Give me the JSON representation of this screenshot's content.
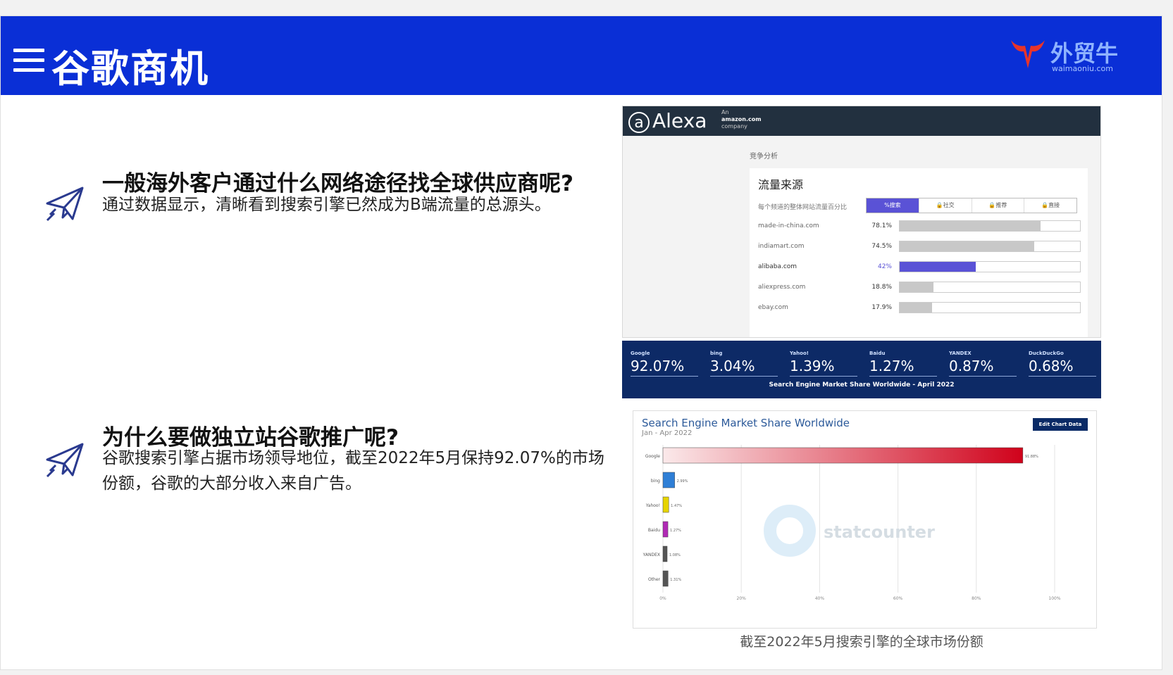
{
  "header": {
    "title": "谷歌商机",
    "brand_name": "外贸牛",
    "brand_url": "waimaoniu.com"
  },
  "section1": {
    "title": "一般海外客户通过什么网络途径找全球供应商呢?",
    "body": "通过数据显示，清晰看到搜索引擎已然成为B端流量的总源头。"
  },
  "section2": {
    "title": "为什么要做独立站谷歌推广呢?",
    "body": "谷歌搜索引擎占据市场领导地位，截至2022年5月保持92.07%的市场份额，谷歌的大部分收入来自广告。"
  },
  "alexa": {
    "logo": "Alexa",
    "tagline_an": "An",
    "tagline_company": "amazon.com",
    "tagline_suffix": "company",
    "breadcrumb": "竞争分析",
    "card_title": "流量来源",
    "card_label": "每个频道的整体网站流量百分比",
    "tabs": [
      "%搜索",
      "🔒社交",
      "🔒推荐",
      "🔒直接"
    ],
    "rows": [
      {
        "site": "made-in-china.com",
        "pct": "78.1%",
        "value": 78.1
      },
      {
        "site": "indiamart.com",
        "pct": "74.5%",
        "value": 74.5
      },
      {
        "site": "alibaba.com",
        "pct": "42%",
        "value": 42
      },
      {
        "site": "aliexpress.com",
        "pct": "18.8%",
        "value": 18.8
      },
      {
        "site": "ebay.com",
        "pct": "17.9%",
        "value": 17.9
      }
    ],
    "highlight_color": "#5a52d6"
  },
  "banner": {
    "items": [
      {
        "name": "Google",
        "value": "92.07%"
      },
      {
        "name": "bing",
        "value": "3.04%"
      },
      {
        "name": "Yahoo!",
        "value": "1.39%"
      },
      {
        "name": "Baidu",
        "value": "1.27%"
      },
      {
        "name": "YANDEX",
        "value": "0.87%"
      },
      {
        "name": "DuckDuckGo",
        "value": "0.68%"
      }
    ],
    "title": "Search Engine Market Share Worldwide - April 2022"
  },
  "chart_data": {
    "type": "bar",
    "title": "Search Engine Market Share Worldwide",
    "subtitle": "Jan - Apr 2022",
    "button": "Edit Chart Data",
    "watermark": "statcounter",
    "categories": [
      "Google",
      "bing",
      "Yahoo!",
      "Baidu",
      "YANDEX",
      "Other"
    ],
    "values": [
      91.88,
      2.99,
      1.47,
      1.27,
      1.08,
      1.31
    ],
    "value_labels": [
      "91.88%",
      "2.99%",
      "1.47%",
      "1.27%",
      "1.08%",
      "1.31%"
    ],
    "colors": [
      "#d0021b",
      "#2f7fd6",
      "#e6d400",
      "#b02ab5",
      "#555555",
      "#555555"
    ],
    "xlim": [
      0,
      100
    ],
    "xticks": [
      "0%",
      "20%",
      "40%",
      "60%",
      "80%",
      "100%"
    ],
    "orientation": "horizontal",
    "grid": true
  },
  "caption": "截至2022年5月搜索引擎的全球市场份额"
}
